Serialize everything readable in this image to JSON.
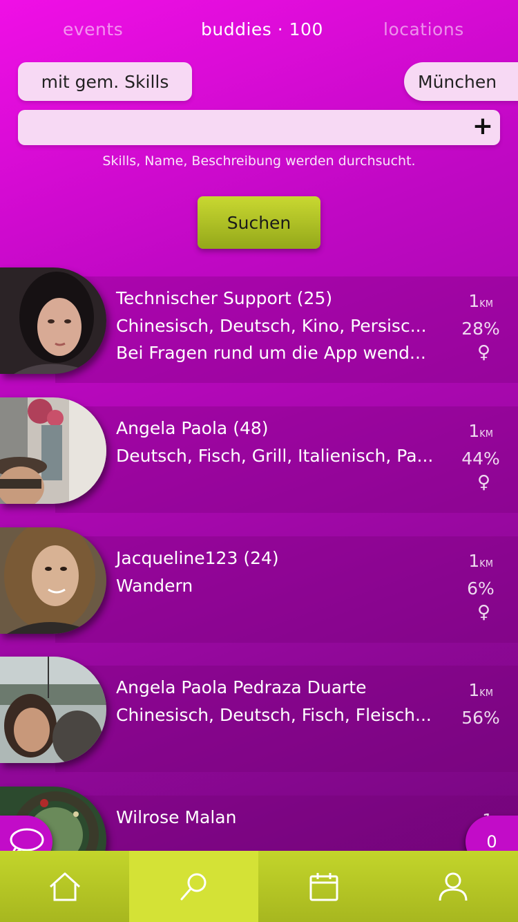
{
  "tabs": [
    {
      "label": "events",
      "active": false
    },
    {
      "label": "buddies · 100",
      "active": true
    },
    {
      "label": "locations",
      "active": false
    }
  ],
  "filter": {
    "skills_pill": "mit gem. Skills",
    "city_pill": "München"
  },
  "search": {
    "value": "",
    "plus_icon": "+",
    "hint": "Skills, Name, Beschreibung werden durchsucht.",
    "button_label": "Suchen"
  },
  "buddies": [
    {
      "name": "Technischer Support (25)",
      "skills": "Chinesisch, Deutsch, Kino, Persisc...",
      "description": "Bei Fragen rund um die App wend...",
      "distance": "1",
      "distance_unit": "KM",
      "match": "28%",
      "gender": "♀"
    },
    {
      "name": "Angela Paola (48)",
      "skills": "Deutsch, Fisch, Grill, Italienisch, Pa...",
      "description": "",
      "distance": "1",
      "distance_unit": "KM",
      "match": "44%",
      "gender": "♀"
    },
    {
      "name": "Jacqueline123 (24)",
      "skills": "Wandern",
      "description": "",
      "distance": "1",
      "distance_unit": "KM",
      "match": "6%",
      "gender": "♀"
    },
    {
      "name": "Angela Paola Pedraza Duarte",
      "skills": "Chinesisch, Deutsch, Fisch, Fleisch...",
      "description": "",
      "distance": "1",
      "distance_unit": "KM",
      "match": "56%",
      "gender": ""
    },
    {
      "name": "Wilrose Malan",
      "skills": "",
      "description": "",
      "distance": "1",
      "distance_unit": "",
      "match": "",
      "gender": ""
    }
  ],
  "fab": {
    "chat_icon": "chat-bubble-icon",
    "count": "0"
  },
  "nav": [
    {
      "icon": "home-icon",
      "active": false
    },
    {
      "icon": "search-icon",
      "active": true
    },
    {
      "icon": "calendar-icon",
      "active": false
    },
    {
      "icon": "user-icon",
      "active": false
    }
  ],
  "colors": {
    "accent_green": "#c3d52b",
    "pill_bg": "#f7d9f4",
    "fab_magenta": "#c20cc8"
  }
}
